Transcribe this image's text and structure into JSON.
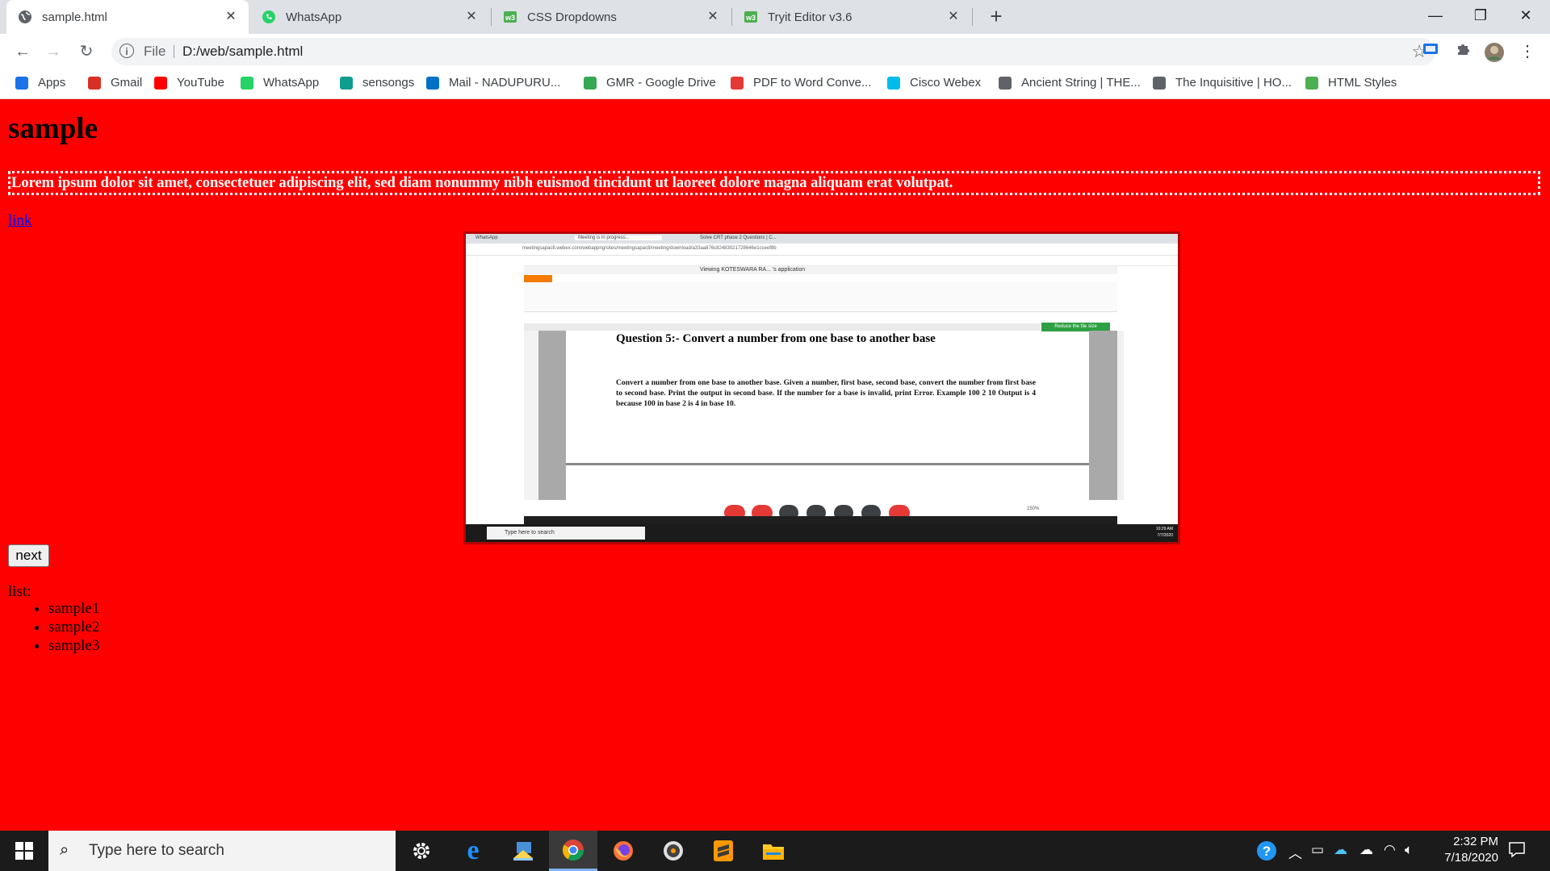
{
  "tabs": [
    {
      "title": "sample.html",
      "active": true
    },
    {
      "title": "WhatsApp",
      "active": false
    },
    {
      "title": "CSS Dropdowns",
      "active": false
    },
    {
      "title": "Tryit Editor v3.6",
      "active": false
    }
  ],
  "toolbar": {
    "scheme": "File",
    "url": "D:/web/sample.html"
  },
  "bookmarks": [
    {
      "label": "Apps",
      "icon": "apps-grid-icon",
      "color": "#1a73e8"
    },
    {
      "label": "Gmail",
      "icon": "gmail-icon",
      "color": "#d93025"
    },
    {
      "label": "YouTube",
      "icon": "youtube-icon",
      "color": "#ff0000"
    },
    {
      "label": "WhatsApp",
      "icon": "whatsapp-icon",
      "color": "#25d366"
    },
    {
      "label": "sensongs",
      "icon": "sensongs-icon",
      "color": "#0f9d8f"
    },
    {
      "label": "Mail - NADUPURU...",
      "icon": "outlook-icon",
      "color": "#0072c6"
    },
    {
      "label": "GMR - Google Drive",
      "icon": "google-drive-icon",
      "color": "#34a853"
    },
    {
      "label": "PDF to Word Conve...",
      "icon": "pdf-converter-icon",
      "color": "#e53935"
    },
    {
      "label": "Cisco Webex",
      "icon": "webex-icon",
      "color": "#00bceb"
    },
    {
      "label": "Ancient String | THE...",
      "icon": "ancient-string-icon",
      "color": "#5f6368"
    },
    {
      "label": "The Inquisitive | HO...",
      "icon": "inquisitive-icon",
      "color": "#5f6368"
    },
    {
      "label": "HTML Styles",
      "icon": "w3schools-icon",
      "color": "#4caf50"
    }
  ],
  "page": {
    "heading": "sample",
    "lorem": "Lorem ipsum dolor sit amet, consectetuer adipiscing elit, sed diam nonummy nibh euismod tincidunt ut laoreet dolore magna aliquam erat volutpat.",
    "link": "link",
    "next_label": "next",
    "list_label": "list:",
    "list_items": [
      "sample1",
      "sample2",
      "sample3"
    ],
    "background": "#ff0000"
  },
  "embedded_screenshot": {
    "tabs": [
      "WhatsApp",
      "Meeting is in progress...",
      "Solve CRT phase 2 Questions | C..."
    ],
    "url": "meetingsapac8.webex.com/webappng/sites/meetingsapac8/meeting/download/a33aa876c82483021728646e1cceef8b",
    "viewing_label": "Viewing KOTESWARA RA... 's application",
    "reduce_label": "Reduce the file size",
    "question_title": "Question 5:- Convert a number from one base to another base",
    "question_body": "Convert a number from one base to another base. Given a number, first base, second base, convert the number from first base to second base. Print the output in second base. If the number for a base is invalid, print Error. Example 100 2 10 Output is 4 because 100 in base 2 is 4 in base 10.",
    "zoom": "150%",
    "taskbar_search": "Type here to search",
    "time": "10:29 AM",
    "date": "7/7/2020"
  },
  "taskbar": {
    "search_placeholder": "Type here to search",
    "time": "2:32 PM",
    "date": "7/18/2020"
  }
}
